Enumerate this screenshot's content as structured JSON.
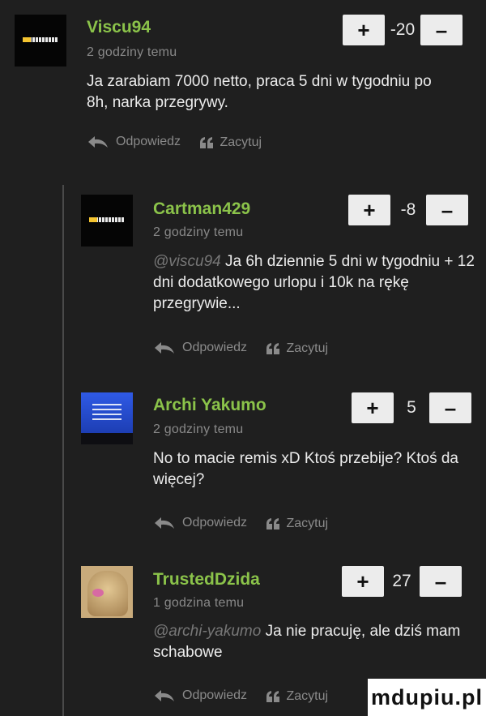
{
  "comments": [
    {
      "username": "Viscu94",
      "time": "2 godziny temu",
      "mention": "",
      "text": "Ja zarabiam 7000 netto, praca 5 dni w tygodniu po 8h, narka przegrywy.",
      "score": "-20"
    },
    {
      "username": "Cartman429",
      "time": "2 godziny temu",
      "mention": "@viscu94",
      "text": " Ja 6h dziennie 5 dni w tygodniu + 12 dni dodatkowego urlopu i 10k na rękę przegrywie...",
      "score": "-8"
    },
    {
      "username": "Archi Yakumo",
      "time": "2 godziny temu",
      "mention": "",
      "text": "No to macie remis xD Ktoś przebije? Ktoś da więcej?",
      "score": "5"
    },
    {
      "username": "TrustedDzida",
      "time": "1 godzina temu",
      "mention": "@archi-yakumo",
      "text": " Ja nie pracuję, ale dziś mam schabowe",
      "score": "27"
    }
  ],
  "actions": {
    "reply": "Odpowiedz",
    "quote": "Zacytuj"
  },
  "vote": {
    "plus": "+",
    "minus": "–"
  },
  "icons": {
    "reply": "reply-arrow-icon",
    "quote": "quote-icon"
  },
  "colors": {
    "username": "#8bc34a",
    "background": "#1f1f1f"
  },
  "watermark": "mdupiu.pl"
}
